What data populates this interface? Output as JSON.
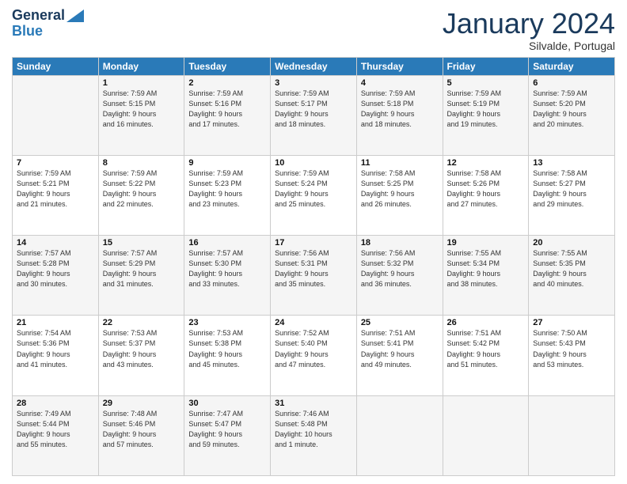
{
  "header": {
    "logo_line1": "General",
    "logo_line2": "Blue",
    "month": "January 2024",
    "location": "Silvalde, Portugal"
  },
  "weekdays": [
    "Sunday",
    "Monday",
    "Tuesday",
    "Wednesday",
    "Thursday",
    "Friday",
    "Saturday"
  ],
  "weeks": [
    [
      {
        "day": "",
        "info": ""
      },
      {
        "day": "1",
        "info": "Sunrise: 7:59 AM\nSunset: 5:15 PM\nDaylight: 9 hours\nand 16 minutes."
      },
      {
        "day": "2",
        "info": "Sunrise: 7:59 AM\nSunset: 5:16 PM\nDaylight: 9 hours\nand 17 minutes."
      },
      {
        "day": "3",
        "info": "Sunrise: 7:59 AM\nSunset: 5:17 PM\nDaylight: 9 hours\nand 18 minutes."
      },
      {
        "day": "4",
        "info": "Sunrise: 7:59 AM\nSunset: 5:18 PM\nDaylight: 9 hours\nand 18 minutes."
      },
      {
        "day": "5",
        "info": "Sunrise: 7:59 AM\nSunset: 5:19 PM\nDaylight: 9 hours\nand 19 minutes."
      },
      {
        "day": "6",
        "info": "Sunrise: 7:59 AM\nSunset: 5:20 PM\nDaylight: 9 hours\nand 20 minutes."
      }
    ],
    [
      {
        "day": "7",
        "info": "Sunrise: 7:59 AM\nSunset: 5:21 PM\nDaylight: 9 hours\nand 21 minutes."
      },
      {
        "day": "8",
        "info": "Sunrise: 7:59 AM\nSunset: 5:22 PM\nDaylight: 9 hours\nand 22 minutes."
      },
      {
        "day": "9",
        "info": "Sunrise: 7:59 AM\nSunset: 5:23 PM\nDaylight: 9 hours\nand 23 minutes."
      },
      {
        "day": "10",
        "info": "Sunrise: 7:59 AM\nSunset: 5:24 PM\nDaylight: 9 hours\nand 25 minutes."
      },
      {
        "day": "11",
        "info": "Sunrise: 7:58 AM\nSunset: 5:25 PM\nDaylight: 9 hours\nand 26 minutes."
      },
      {
        "day": "12",
        "info": "Sunrise: 7:58 AM\nSunset: 5:26 PM\nDaylight: 9 hours\nand 27 minutes."
      },
      {
        "day": "13",
        "info": "Sunrise: 7:58 AM\nSunset: 5:27 PM\nDaylight: 9 hours\nand 29 minutes."
      }
    ],
    [
      {
        "day": "14",
        "info": "Sunrise: 7:57 AM\nSunset: 5:28 PM\nDaylight: 9 hours\nand 30 minutes."
      },
      {
        "day": "15",
        "info": "Sunrise: 7:57 AM\nSunset: 5:29 PM\nDaylight: 9 hours\nand 31 minutes."
      },
      {
        "day": "16",
        "info": "Sunrise: 7:57 AM\nSunset: 5:30 PM\nDaylight: 9 hours\nand 33 minutes."
      },
      {
        "day": "17",
        "info": "Sunrise: 7:56 AM\nSunset: 5:31 PM\nDaylight: 9 hours\nand 35 minutes."
      },
      {
        "day": "18",
        "info": "Sunrise: 7:56 AM\nSunset: 5:32 PM\nDaylight: 9 hours\nand 36 minutes."
      },
      {
        "day": "19",
        "info": "Sunrise: 7:55 AM\nSunset: 5:34 PM\nDaylight: 9 hours\nand 38 minutes."
      },
      {
        "day": "20",
        "info": "Sunrise: 7:55 AM\nSunset: 5:35 PM\nDaylight: 9 hours\nand 40 minutes."
      }
    ],
    [
      {
        "day": "21",
        "info": "Sunrise: 7:54 AM\nSunset: 5:36 PM\nDaylight: 9 hours\nand 41 minutes."
      },
      {
        "day": "22",
        "info": "Sunrise: 7:53 AM\nSunset: 5:37 PM\nDaylight: 9 hours\nand 43 minutes."
      },
      {
        "day": "23",
        "info": "Sunrise: 7:53 AM\nSunset: 5:38 PM\nDaylight: 9 hours\nand 45 minutes."
      },
      {
        "day": "24",
        "info": "Sunrise: 7:52 AM\nSunset: 5:40 PM\nDaylight: 9 hours\nand 47 minutes."
      },
      {
        "day": "25",
        "info": "Sunrise: 7:51 AM\nSunset: 5:41 PM\nDaylight: 9 hours\nand 49 minutes."
      },
      {
        "day": "26",
        "info": "Sunrise: 7:51 AM\nSunset: 5:42 PM\nDaylight: 9 hours\nand 51 minutes."
      },
      {
        "day": "27",
        "info": "Sunrise: 7:50 AM\nSunset: 5:43 PM\nDaylight: 9 hours\nand 53 minutes."
      }
    ],
    [
      {
        "day": "28",
        "info": "Sunrise: 7:49 AM\nSunset: 5:44 PM\nDaylight: 9 hours\nand 55 minutes."
      },
      {
        "day": "29",
        "info": "Sunrise: 7:48 AM\nSunset: 5:46 PM\nDaylight: 9 hours\nand 57 minutes."
      },
      {
        "day": "30",
        "info": "Sunrise: 7:47 AM\nSunset: 5:47 PM\nDaylight: 9 hours\nand 59 minutes."
      },
      {
        "day": "31",
        "info": "Sunrise: 7:46 AM\nSunset: 5:48 PM\nDaylight: 10 hours\nand 1 minute."
      },
      {
        "day": "",
        "info": ""
      },
      {
        "day": "",
        "info": ""
      },
      {
        "day": "",
        "info": ""
      }
    ]
  ]
}
